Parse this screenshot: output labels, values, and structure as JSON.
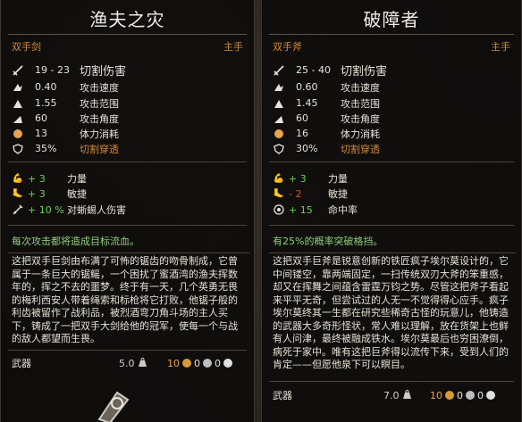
{
  "left": {
    "title": "渔夫之灾",
    "weapon_type": "双手剑",
    "hand": "主手",
    "stats": [
      {
        "icon": "cut-damage-icon",
        "value": "19 - 23",
        "label": "切割伤害"
      },
      {
        "icon": "attack-speed-icon",
        "value": "0.40",
        "label": "攻击速度"
      },
      {
        "icon": "attack-range-icon",
        "value": "1.55",
        "label": "攻击范围"
      },
      {
        "icon": "attack-angle-icon",
        "value": "60",
        "label": "攻击角度"
      },
      {
        "icon": "stamina-icon",
        "value": "13",
        "label": "体力消耗"
      },
      {
        "icon": "cut-penetration-icon",
        "value": "35%",
        "label": "切割穿透"
      }
    ],
    "bonuses": [
      {
        "icon": "strength-icon",
        "value": "+ 3",
        "label": "力量",
        "color": "#6fd05a"
      },
      {
        "icon": "agility-icon",
        "value": "+ 3",
        "label": "敏捷",
        "color": "#6fd05a"
      },
      {
        "icon": "sword-icon",
        "value": "+ 10 %",
        "label": "对蜥蜴人伤害",
        "color": "#6fd05a"
      }
    ],
    "special": "每次攻击都将造成目标流血。",
    "description": "这把双手巨剑由布满了可怖的锯齿的吻骨制成，它曾属于一条巨大的锯鳐，一个困扰了蜜酒湾的渔夫挥数年的，挥之不去的噩梦。终于有一天，几个英勇无畏的梅利西安人带着绳索和标枪将它打败，他锯子般的利齿被留作了战利品，被烈酒弯刀角斗场的主人买下，铸成了一把双手大剑给他的冠军，使每一个与战的敌人都望而生畏。",
    "category": "武器",
    "weight": "5.0",
    "price": {
      "gold": "10",
      "silver": "0",
      "copper": "0"
    }
  },
  "right": {
    "title": "破障者",
    "weapon_type": "双手斧",
    "hand": "主手",
    "stats": [
      {
        "icon": "cut-damage-icon",
        "value": "25 - 40",
        "label": "切割伤害"
      },
      {
        "icon": "attack-speed-icon",
        "value": "0.60",
        "label": "攻击速度"
      },
      {
        "icon": "attack-range-icon",
        "value": "1.45",
        "label": "攻击范围"
      },
      {
        "icon": "attack-angle-icon",
        "value": "60",
        "label": "攻击角度"
      },
      {
        "icon": "stamina-icon",
        "value": "16",
        "label": "体力消耗"
      },
      {
        "icon": "cut-penetration-icon",
        "value": "30%",
        "label": "切割穿透"
      }
    ],
    "bonuses": [
      {
        "icon": "strength-icon",
        "value": "+ 3",
        "label": "力量",
        "color": "#6fd05a"
      },
      {
        "icon": "agility-icon",
        "value": "- 2",
        "label": "敏捷",
        "color": "#e04a3a"
      },
      {
        "icon": "accuracy-icon",
        "value": "+ 15",
        "label": "命中率",
        "color": "#6fd05a"
      }
    ],
    "special": "有25%的概率突破格挡。",
    "description": "这把双手巨斧是锐意创新的铁匠疯子埃尔莫设计的，它中间镂空，靠两端固定，一扫传统双刃大斧的笨重感，却又在挥舞之间蕴含雷霆万钧之势。尽管这把斧子看起来平平无奇，但尝试过的人无一不觉得得心应手。疯子埃尔莫终其一生都在研究些稀奇古怪的玩意儿，他铸造的武器大多奇形怪状，常人难以理解，放在货架上也鲜有人问津，最终被融成铁水。埃尔莫最后也穷困潦倒，病死于家中。唯有这把巨斧得以流传下来，受到人们的肯定——但愿他泉下可以瞑目。",
    "category": "武器",
    "weight": "7.0",
    "price": {
      "gold": "10",
      "silver": "0",
      "copper": "0"
    }
  }
}
